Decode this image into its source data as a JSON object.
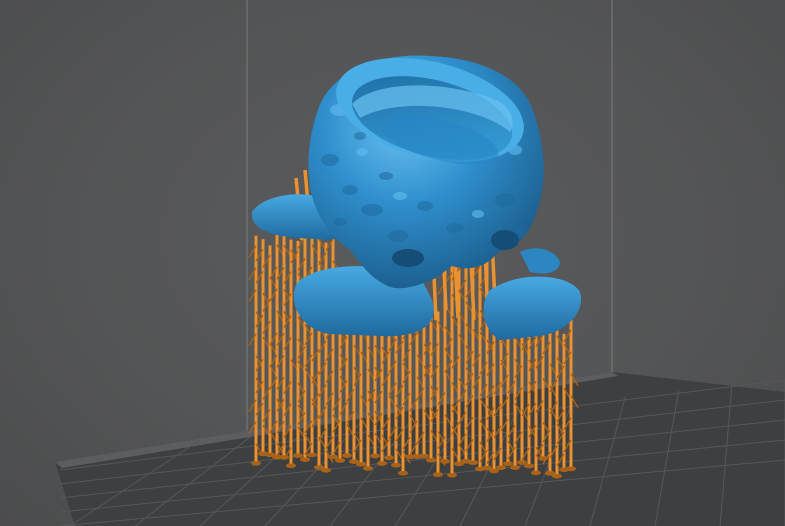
{
  "viewport": {
    "label": "",
    "colors": {
      "background": "#545556",
      "build_volume_lines": "#7b7c7e",
      "build_plate": "#3d3e40",
      "plate_grid": "#56575a",
      "model": "#2f8fcd",
      "model_highlight": "#5fb8ec",
      "model_shadow": "#1c5f8e",
      "supports": "#e9922f",
      "supports_shadow": "#a9621a"
    },
    "model": {
      "kind": "sculpted skull-shaped ring with hollow top",
      "icon": "3d-model-icon"
    },
    "supports": {
      "kind": "tree/lattice support structures",
      "icon": "support-structure-icon"
    }
  }
}
